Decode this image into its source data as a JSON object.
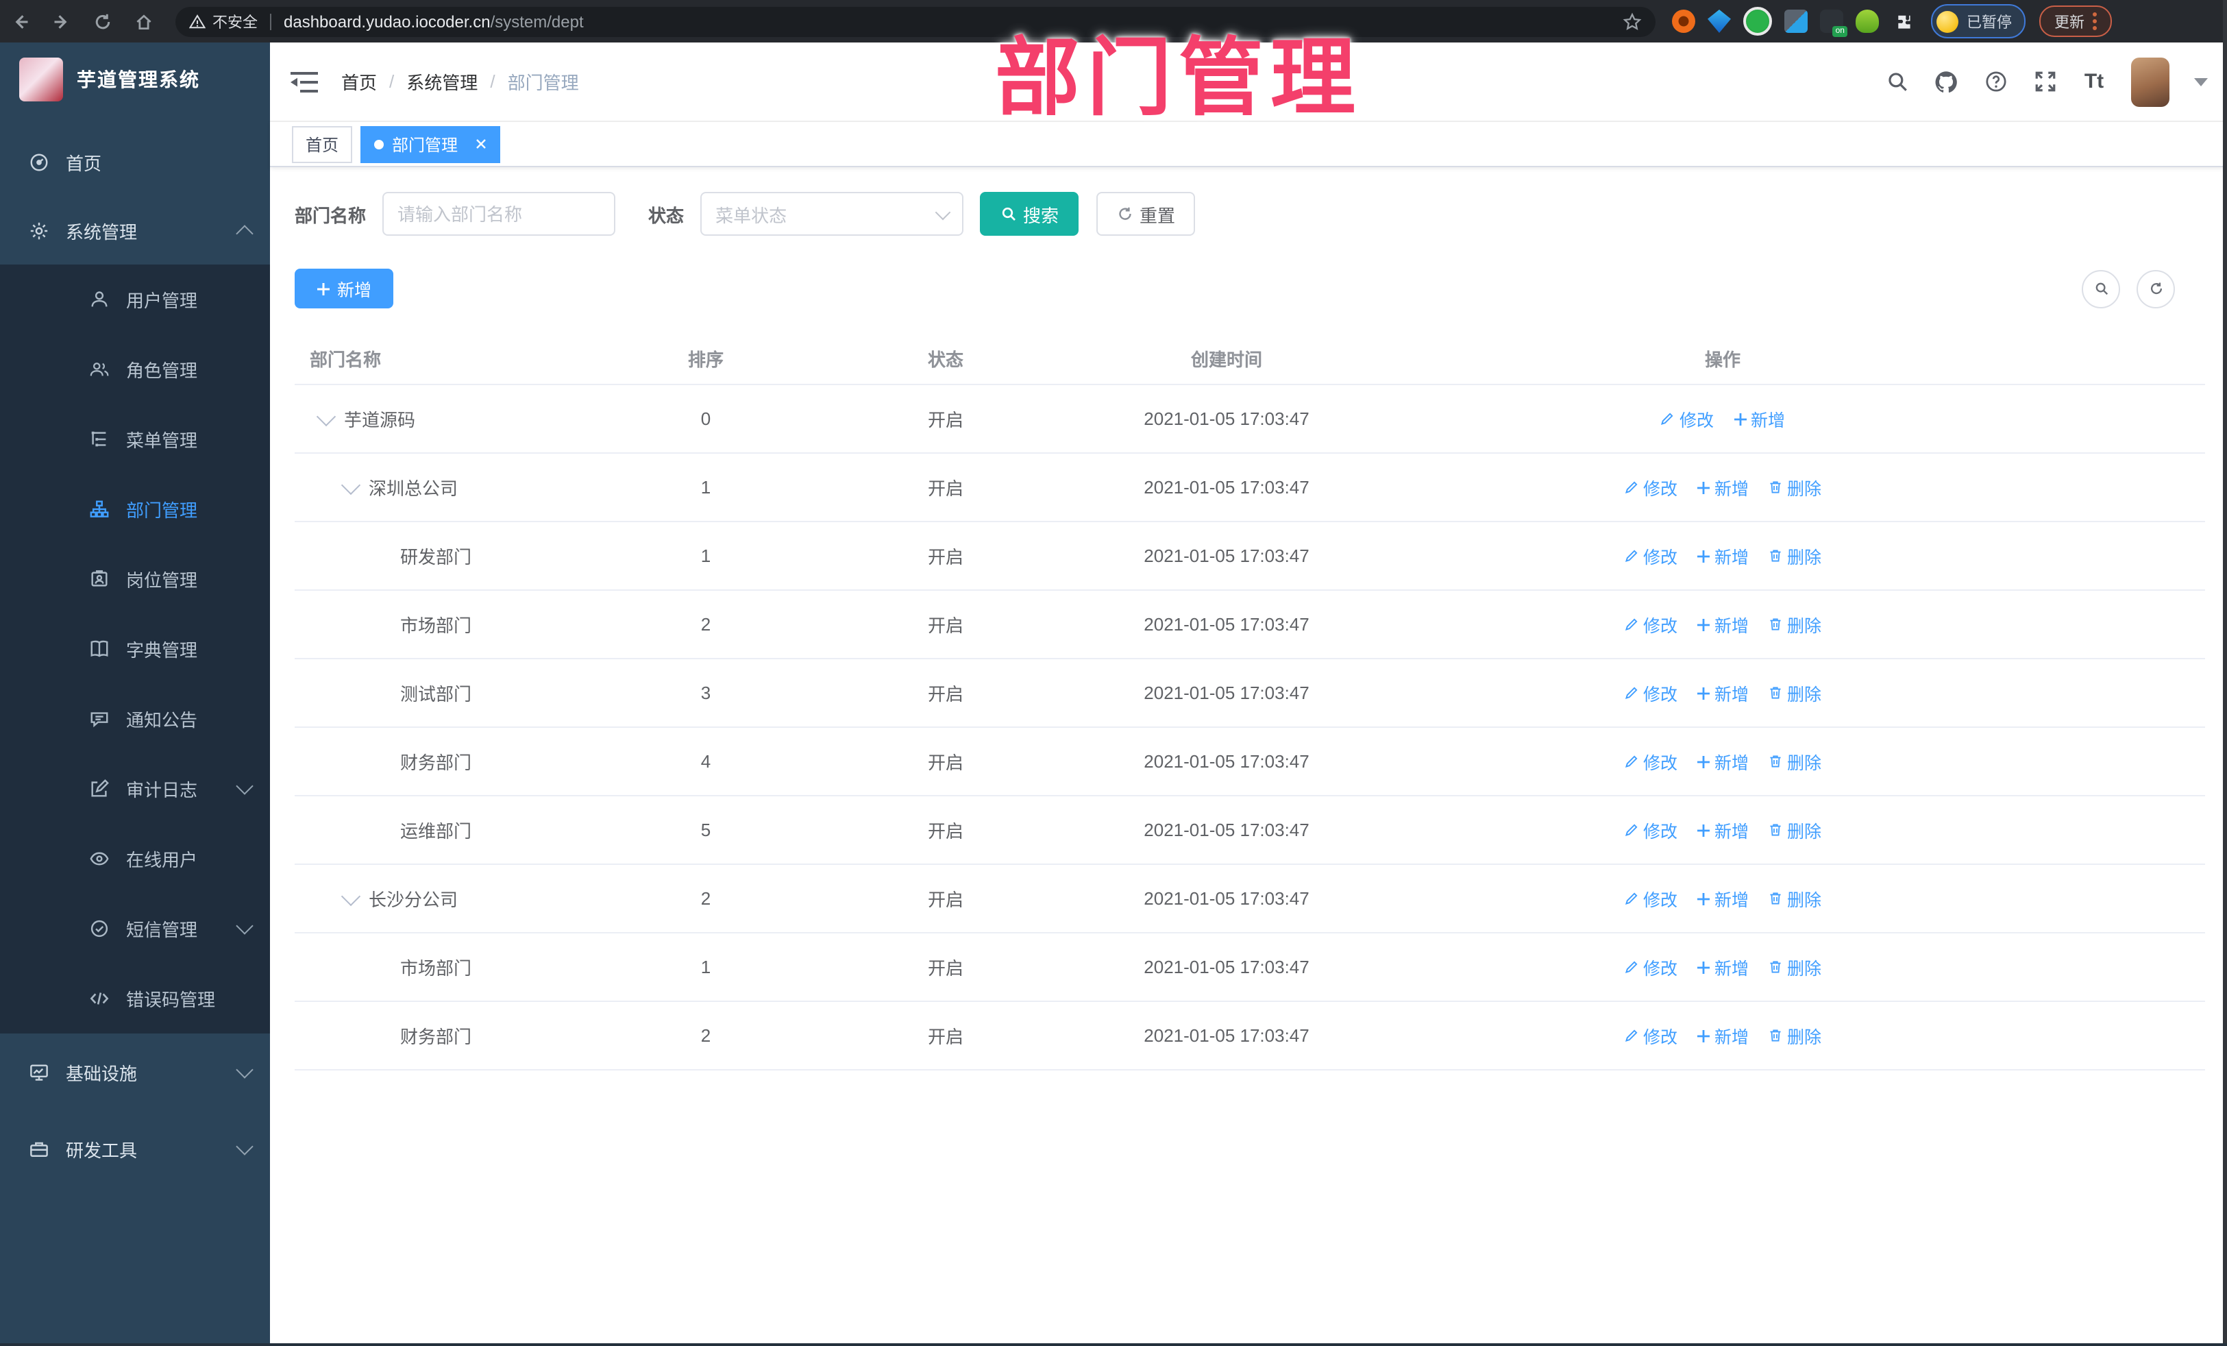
{
  "browser": {
    "security_label": "不安全",
    "url_host": "dashboard.yudao.iocoder.cn",
    "url_path": "/system/dept",
    "paused_label": "已暂停",
    "update_label": "更新"
  },
  "annotation": {
    "text": "部门管理"
  },
  "sidebar": {
    "title": "芋道管理系统",
    "menu": [
      {
        "label": "首页",
        "icon": "dashboard-icon"
      },
      {
        "label": "系统管理",
        "icon": "gear-icon",
        "state": "expanded"
      },
      {
        "label": "用户管理",
        "icon": "user-icon"
      },
      {
        "label": "角色管理",
        "icon": "users-icon"
      },
      {
        "label": "菜单管理",
        "icon": "menu-list-icon"
      },
      {
        "label": "部门管理",
        "icon": "org-tree-icon",
        "active": true
      },
      {
        "label": "岗位管理",
        "icon": "badge-icon"
      },
      {
        "label": "字典管理",
        "icon": "book-icon"
      },
      {
        "label": "通知公告",
        "icon": "announcement-icon"
      },
      {
        "label": "审计日志",
        "icon": "audit-log-icon",
        "state": "collapsed"
      },
      {
        "label": "在线用户",
        "icon": "online-users-icon"
      },
      {
        "label": "短信管理",
        "icon": "sms-icon",
        "state": "collapsed"
      },
      {
        "label": "错误码管理",
        "icon": "error-code-icon"
      },
      {
        "label": "基础设施",
        "icon": "infrastructure-icon",
        "state": "collapsed"
      },
      {
        "label": "研发工具",
        "icon": "dev-tools-icon",
        "state": "collapsed"
      }
    ]
  },
  "header": {
    "breadcrumb": [
      "首页",
      "系统管理",
      "部门管理"
    ],
    "separator": "/",
    "font_icon_text": "Tt"
  },
  "tabs": [
    {
      "label": "首页",
      "active": false
    },
    {
      "label": "部门管理",
      "active": true
    }
  ],
  "filters": {
    "name_label": "部门名称",
    "name_placeholder": "请输入部门名称",
    "status_label": "状态",
    "status_placeholder": "菜单状态",
    "search_label": "搜索",
    "reset_label": "重置"
  },
  "toolbar": {
    "add_label": "新增"
  },
  "table": {
    "columns": [
      "部门名称",
      "排序",
      "状态",
      "创建时间",
      "操作"
    ],
    "action_labels": {
      "edit": "修改",
      "add": "新增",
      "delete": "删除"
    },
    "rows": [
      {
        "name": "芋道源码",
        "level": 0,
        "expandable": true,
        "sort": "0",
        "status": "开启",
        "created": "2021-01-05 17:03:47",
        "can_delete": false
      },
      {
        "name": "深圳总公司",
        "level": 1,
        "expandable": true,
        "sort": "1",
        "status": "开启",
        "created": "2021-01-05 17:03:47",
        "can_delete": true
      },
      {
        "name": "研发部门",
        "level": 2,
        "expandable": false,
        "sort": "1",
        "status": "开启",
        "created": "2021-01-05 17:03:47",
        "can_delete": true
      },
      {
        "name": "市场部门",
        "level": 2,
        "expandable": false,
        "sort": "2",
        "status": "开启",
        "created": "2021-01-05 17:03:47",
        "can_delete": true
      },
      {
        "name": "测试部门",
        "level": 2,
        "expandable": false,
        "sort": "3",
        "status": "开启",
        "created": "2021-01-05 17:03:47",
        "can_delete": true
      },
      {
        "name": "财务部门",
        "level": 2,
        "expandable": false,
        "sort": "4",
        "status": "开启",
        "created": "2021-01-05 17:03:47",
        "can_delete": true
      },
      {
        "name": "运维部门",
        "level": 2,
        "expandable": false,
        "sort": "5",
        "status": "开启",
        "created": "2021-01-05 17:03:47",
        "can_delete": true
      },
      {
        "name": "长沙分公司",
        "level": 1,
        "expandable": true,
        "sort": "2",
        "status": "开启",
        "created": "2021-01-05 17:03:47",
        "can_delete": true
      },
      {
        "name": "市场部门",
        "level": 2,
        "expandable": false,
        "sort": "1",
        "status": "开启",
        "created": "2021-01-05 17:03:47",
        "can_delete": true
      },
      {
        "name": "财务部门",
        "level": 2,
        "expandable": false,
        "sort": "2",
        "status": "开启",
        "created": "2021-01-05 17:03:47",
        "can_delete": true
      }
    ]
  },
  "colors": {
    "accent_blue": "#409EFF",
    "search_teal": "#17b3a3",
    "annotation_pink": "#f43f6b",
    "sidebar_bg": "#2b4459",
    "submenu_bg": "#1f2d3d"
  }
}
